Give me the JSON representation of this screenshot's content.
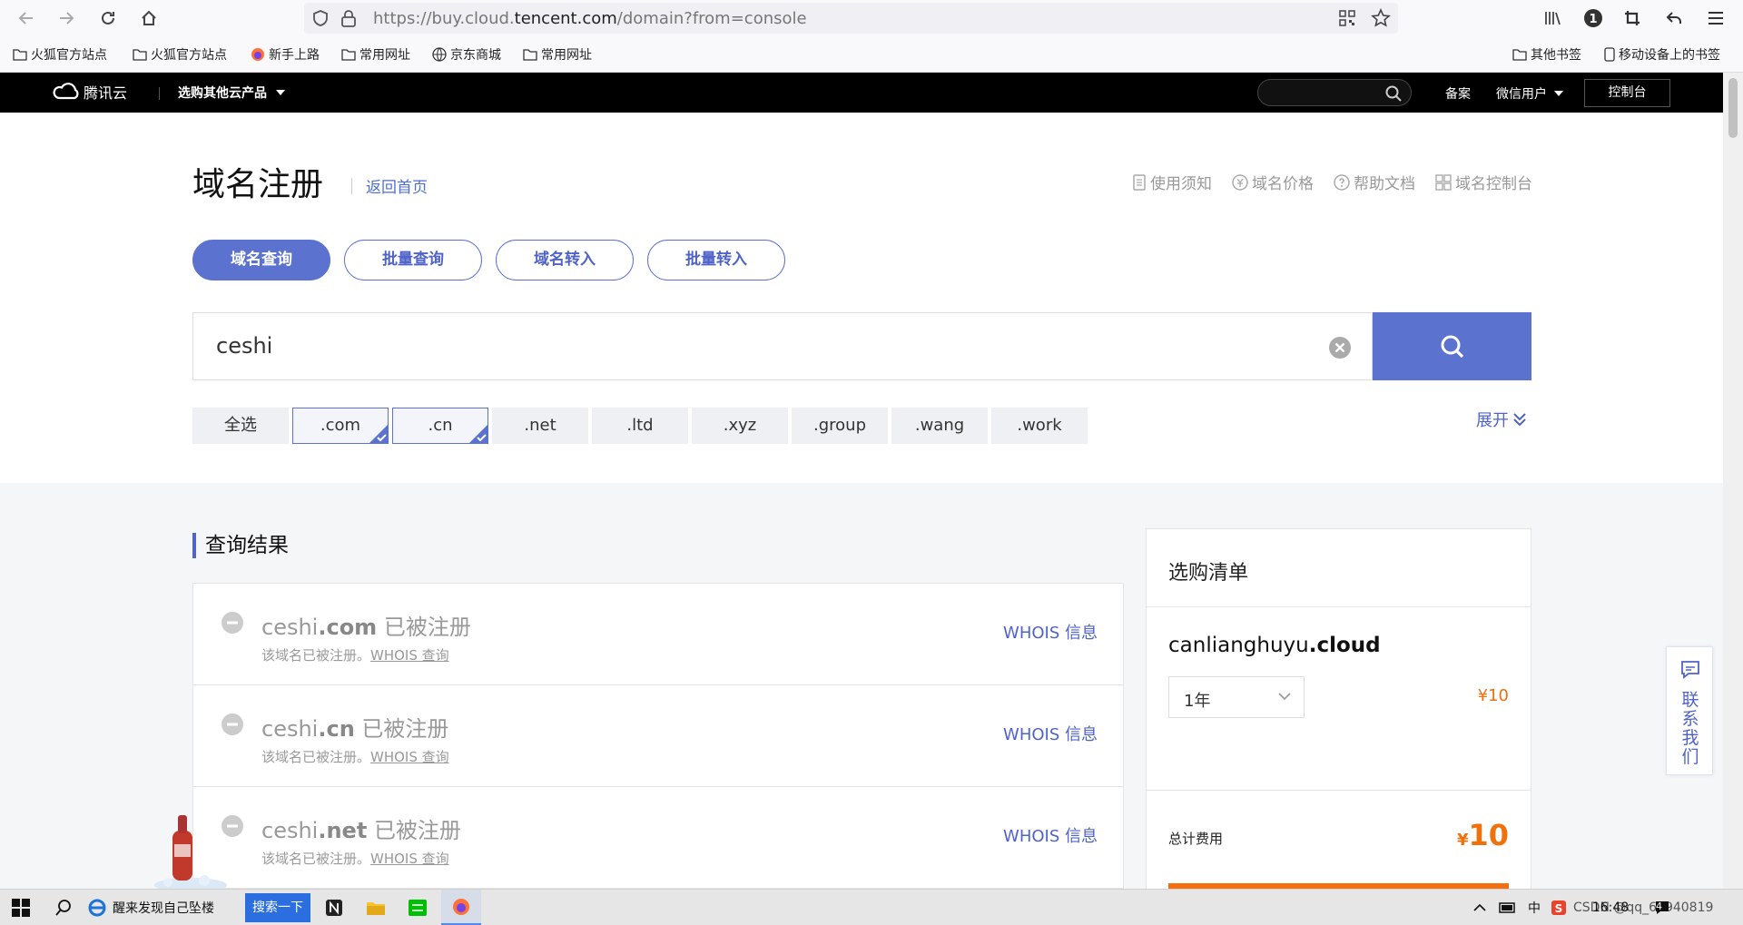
{
  "browser": {
    "url_prefix": "https://buy.cloud.",
    "url_domain": "tencent.com",
    "url_suffix": "/domain?from=console",
    "bookmarks": [
      {
        "label": "火狐官方站点",
        "icon": "folder-icon"
      },
      {
        "label": "火狐官方站点",
        "icon": "folder-icon"
      },
      {
        "label": "新手上路",
        "icon": "firefox-icon"
      },
      {
        "label": "常用网址",
        "icon": "folder-icon"
      },
      {
        "label": "京东商城",
        "icon": "globe-icon"
      },
      {
        "label": "常用网址",
        "icon": "folder-icon"
      }
    ],
    "bookmarks_right": [
      {
        "label": "其他书签",
        "icon": "folder-icon"
      },
      {
        "label": "移动设备上的书签",
        "icon": "phone-icon"
      }
    ]
  },
  "header": {
    "logo_text": "腾讯云",
    "products_label": "选购其他云产品",
    "beian": "备案",
    "user": "微信用户",
    "console": "控制台"
  },
  "main": {
    "title": "域名注册",
    "back_link": "返回首页",
    "top_links": [
      "使用须知",
      "域名价格",
      "帮助文档",
      "域名控制台"
    ],
    "tabs": [
      "域名查询",
      "批量查询",
      "域名转入",
      "批量转入"
    ],
    "active_tab": 0,
    "search_value": "ceshi",
    "suffixes": [
      {
        "label": "全选",
        "selected": false
      },
      {
        "label": ".com",
        "selected": true
      },
      {
        "label": ".cn",
        "selected": true
      },
      {
        "label": ".net",
        "selected": false
      },
      {
        "label": ".ltd",
        "selected": false
      },
      {
        "label": ".xyz",
        "selected": false
      },
      {
        "label": ".group",
        "selected": false
      },
      {
        "label": ".wang",
        "selected": false
      },
      {
        "label": ".work",
        "selected": false
      }
    ],
    "expand_label": "展开"
  },
  "results": {
    "title": "查询结果",
    "rows": [
      {
        "name": "ceshi",
        "tld": ".com",
        "status": "已被注册",
        "note": "该域名已被注册。",
        "note_link": "WHOIS 查询",
        "action": "WHOIS 信息"
      },
      {
        "name": "ceshi",
        "tld": ".cn",
        "status": "已被注册",
        "note": "该域名已被注册。",
        "note_link": "WHOIS 查询",
        "action": "WHOIS 信息"
      },
      {
        "name": "ceshi",
        "tld": ".net",
        "status": "已被注册",
        "note": "该域名已被注册。",
        "note_link": "WHOIS 查询",
        "action": "WHOIS 信息"
      }
    ]
  },
  "cart": {
    "title": "选购清单",
    "domain_name": "canlianghuyu",
    "domain_tld": ".cloud",
    "period": "1年",
    "price": "¥10",
    "total_label": "总计费用",
    "total_currency": "¥",
    "total_value": "10"
  },
  "contact": {
    "label": "联系我们"
  },
  "taskbar": {
    "app_title": "醒来发现自己坠楼",
    "search_button": "搜索一下",
    "ime": "中",
    "clock": "16:48",
    "watermark": "CSDN @qq_63940819",
    "notification_count": "4"
  },
  "colors": {
    "accent": "#5b72cf",
    "price": "#f0700c",
    "header_bg": "#000000"
  }
}
